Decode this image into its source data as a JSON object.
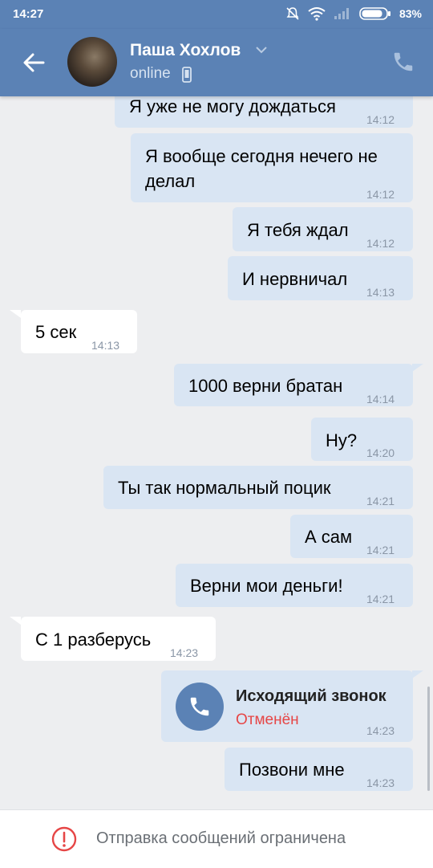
{
  "status_bar": {
    "time": "14:27",
    "battery": "83%"
  },
  "header": {
    "name": "Паша Хохлов",
    "status": "online"
  },
  "messages": [
    {
      "text": "Я уже не могу дождаться",
      "time": "14:12"
    },
    {
      "text": "Я вообще сегодня нечего не",
      "text2": "делал",
      "time": "14:12"
    },
    {
      "text": "Я тебя ждал",
      "time": "14:12"
    },
    {
      "text": "И нервничал",
      "time": "14:13"
    },
    {
      "text": "5 сек",
      "time": "14:13"
    },
    {
      "text": "1000 верни братан",
      "time": "14:14"
    },
    {
      "text": "Ну?",
      "time": "14:20"
    },
    {
      "text": "Ты так нормальный поцик",
      "time": "14:21"
    },
    {
      "text": "А сам",
      "time": "14:21"
    },
    {
      "text": "Верни мои деньги!",
      "time": "14:21"
    },
    {
      "text": "С 1 разберусь",
      "time": "14:23"
    },
    {
      "call_title": "Исходящий звонок",
      "call_status": "Отменён",
      "time": "14:23"
    },
    {
      "text": "Позвони мне",
      "time": "14:23"
    }
  ],
  "bottom_bar": {
    "text": "Отправка сообщений ограничена"
  },
  "colors": {
    "header_bg": "#5b82b5",
    "outgoing_bubble": "#d9e5f3",
    "incoming_bubble": "#ffffff",
    "chat_bg": "#edeef0",
    "cancelled_red": "#e64646"
  }
}
